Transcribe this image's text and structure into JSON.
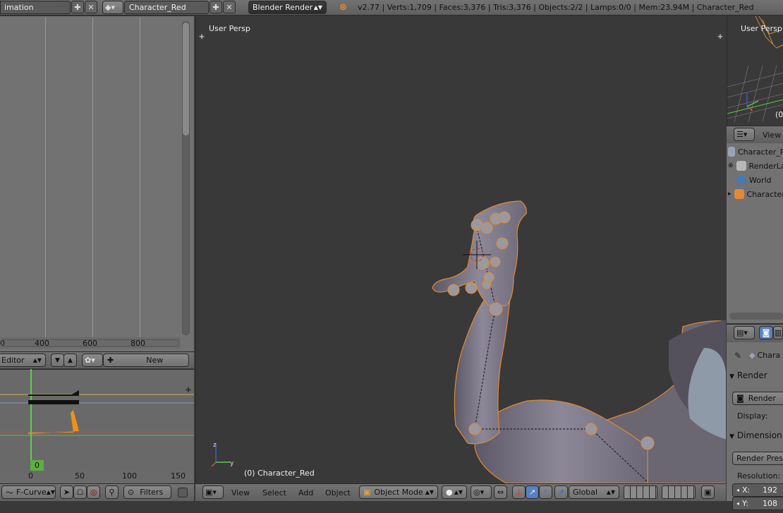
{
  "top_header": {
    "screen_layout_label": "imation",
    "scene_name": "Character_Red",
    "render_engine": "Blender Render",
    "stats": "v2.77 | Verts:1,709 | Faces:3,376 | Tris:3,376 | Objects:2/2 | Lamps:0/0 | Mem:23.94M | Character_Red"
  },
  "left_editor": {
    "ruler_ticks": [
      "0",
      "400",
      "600",
      "800"
    ],
    "header": {
      "editor_label": "Editor",
      "new_button": "New"
    }
  },
  "graph_editor": {
    "current_frame": "0",
    "ruler_ticks": [
      "0",
      "50",
      "100",
      "150"
    ],
    "footer": {
      "mode_label": "F-Curve",
      "filters_label": "Filters"
    }
  },
  "viewport": {
    "view_label": "User Persp",
    "object_label": "(0) Character_Red",
    "header": {
      "menu_view": "View",
      "menu_select": "Select",
      "menu_add": "Add",
      "menu_object": "Object",
      "mode": "Object Mode",
      "orientation": "Global"
    }
  },
  "right_mini_viewport": {
    "view_label": "User Persp",
    "frame_label": "(0"
  },
  "outliner": {
    "view_menu": "View",
    "items": [
      {
        "label": "Character_Re",
        "icon_color": "#9aa4b8"
      },
      {
        "label": "RenderLa",
        "icon_color": "#b8b8b8"
      },
      {
        "label": "World",
        "icon_color": "#4a78b0"
      },
      {
        "label": "Character",
        "icon_color": "#e08a3a"
      }
    ]
  },
  "properties": {
    "context_name": "Chara",
    "render_panel": "Render",
    "render_button": "Render",
    "display_label": "Display:",
    "dimensions_panel": "Dimension",
    "render_presets": "Render Prese",
    "resolution_label": "Resolution:",
    "res_x": "X:",
    "res_x_value": "192",
    "res_y": "Y:",
    "res_y_value": "108"
  }
}
